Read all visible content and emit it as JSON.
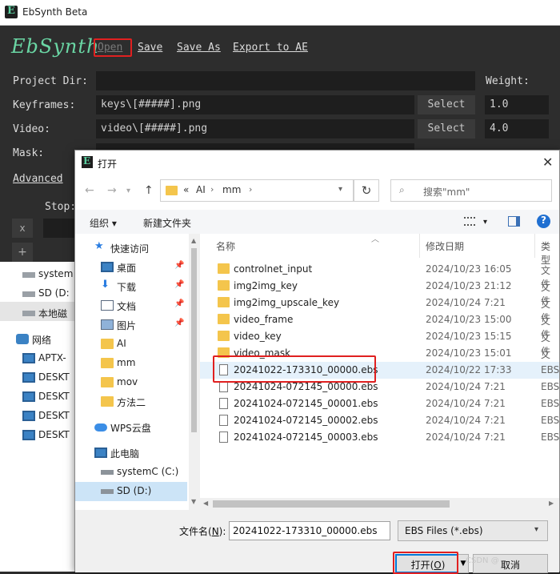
{
  "app": {
    "title": "EbSynth Beta",
    "logo_text": "EbSynth",
    "menu": [
      "Open",
      "Save",
      "Save As",
      "Export to AE"
    ],
    "labels": {
      "project_dir": "Project Dir:",
      "keyframes": "Keyframes:",
      "video": "Video:",
      "mask": "Mask:",
      "weight": "Weight:",
      "advanced": "Advanced",
      "stop": "Stop:"
    },
    "keyframes_value": "keys\\[#####].png",
    "video_value": "video\\[#####].png",
    "select_label": "Select",
    "keyframes_weight": "1.0",
    "video_weight": "4.0",
    "x_button": "x",
    "plus_button": "+"
  },
  "background_explorer": {
    "items": [
      {
        "label": "system",
        "icon": "drive-icon"
      },
      {
        "label": "SD (D:",
        "icon": "drive-icon"
      },
      {
        "label": "本地磁",
        "icon": "drive-icon"
      },
      {
        "label": "网络",
        "icon": "network-icon"
      },
      {
        "label": "APTX-",
        "icon": "computer-icon"
      },
      {
        "label": "DESKT",
        "icon": "computer-icon"
      },
      {
        "label": "DESKT",
        "icon": "computer-icon"
      },
      {
        "label": "DESKT",
        "icon": "computer-icon"
      },
      {
        "label": "DESKT",
        "icon": "computer-icon"
      }
    ]
  },
  "dialog": {
    "title": "打开",
    "close": "✕",
    "breadcrumb": {
      "prefix": "«",
      "parts": [
        "AI",
        "mm"
      ]
    },
    "refresh": "↻",
    "search_placeholder": "搜索\"mm\"",
    "toolbar": {
      "organize": "组织 ▾",
      "new_folder": "新建文件夹",
      "help": "?"
    },
    "nav": [
      {
        "label": "快速访问",
        "icon": "star-icon",
        "pinned": false
      },
      {
        "label": "桌面",
        "icon": "desktop-icon",
        "pinned": true
      },
      {
        "label": "下载",
        "icon": "download-icon",
        "pinned": true
      },
      {
        "label": "文档",
        "icon": "document-icon",
        "pinned": true
      },
      {
        "label": "图片",
        "icon": "picture-icon",
        "pinned": true
      },
      {
        "label": "AI",
        "icon": "folder-icon",
        "pinned": false
      },
      {
        "label": "mm",
        "icon": "folder-icon",
        "pinned": false
      },
      {
        "label": "mov",
        "icon": "folder-icon",
        "pinned": false
      },
      {
        "label": "方法二",
        "icon": "folder-icon",
        "pinned": false
      },
      {
        "label": "WPS云盘",
        "icon": "cloud-icon",
        "pinned": false
      },
      {
        "label": "此电脑",
        "icon": "computer-icon",
        "pinned": false
      },
      {
        "label": "systemC (C:)",
        "icon": "drive-icon",
        "pinned": false
      },
      {
        "label": "SD (D:)",
        "icon": "drive-icon",
        "pinned": false
      }
    ],
    "columns": {
      "name": "名称",
      "date": "修改日期",
      "type": "类型"
    },
    "files": [
      {
        "name": "controlnet_input",
        "date": "2024/10/23 16:05",
        "type": "文件",
        "kind": "folder"
      },
      {
        "name": "img2img_key",
        "date": "2024/10/23 21:12",
        "type": "文件",
        "kind": "folder"
      },
      {
        "name": "img2img_upscale_key",
        "date": "2024/10/24 7:21",
        "type": "文件",
        "kind": "folder"
      },
      {
        "name": "video_frame",
        "date": "2024/10/23 15:00",
        "type": "文件",
        "kind": "folder"
      },
      {
        "name": "video_key",
        "date": "2024/10/23 15:15",
        "type": "文件",
        "kind": "folder"
      },
      {
        "name": "video_mask",
        "date": "2024/10/23 15:01",
        "type": "文件",
        "kind": "folder"
      },
      {
        "name": "20241022-173310_00000.ebs",
        "date": "2024/10/22 17:33",
        "type": "EBS",
        "kind": "file"
      },
      {
        "name": "20241024-072145_00000.ebs",
        "date": "2024/10/24 7:21",
        "type": "EBS",
        "kind": "file"
      },
      {
        "name": "20241024-072145_00001.ebs",
        "date": "2024/10/24 7:21",
        "type": "EBS",
        "kind": "file"
      },
      {
        "name": "20241024-072145_00002.ebs",
        "date": "2024/10/24 7:21",
        "type": "EBS",
        "kind": "file"
      },
      {
        "name": "20241024-072145_00003.ebs",
        "date": "2024/10/24 7:21",
        "type": "EBS",
        "kind": "file"
      }
    ],
    "filename_label": "文件名(",
    "filename_key": "N",
    "filename_label_end": "):",
    "filename_value": "20241022-173310_00000.ebs",
    "filetype_value": "EBS Files (*.ebs)",
    "open_label": "打开(",
    "open_key": "O",
    "open_label_end": ")",
    "cancel_label": "取消"
  },
  "watermark": "CSDN @",
  "colors": {
    "accent": "#6ad6a4",
    "highlight": "#e02020",
    "selection": "#cce4f7"
  }
}
